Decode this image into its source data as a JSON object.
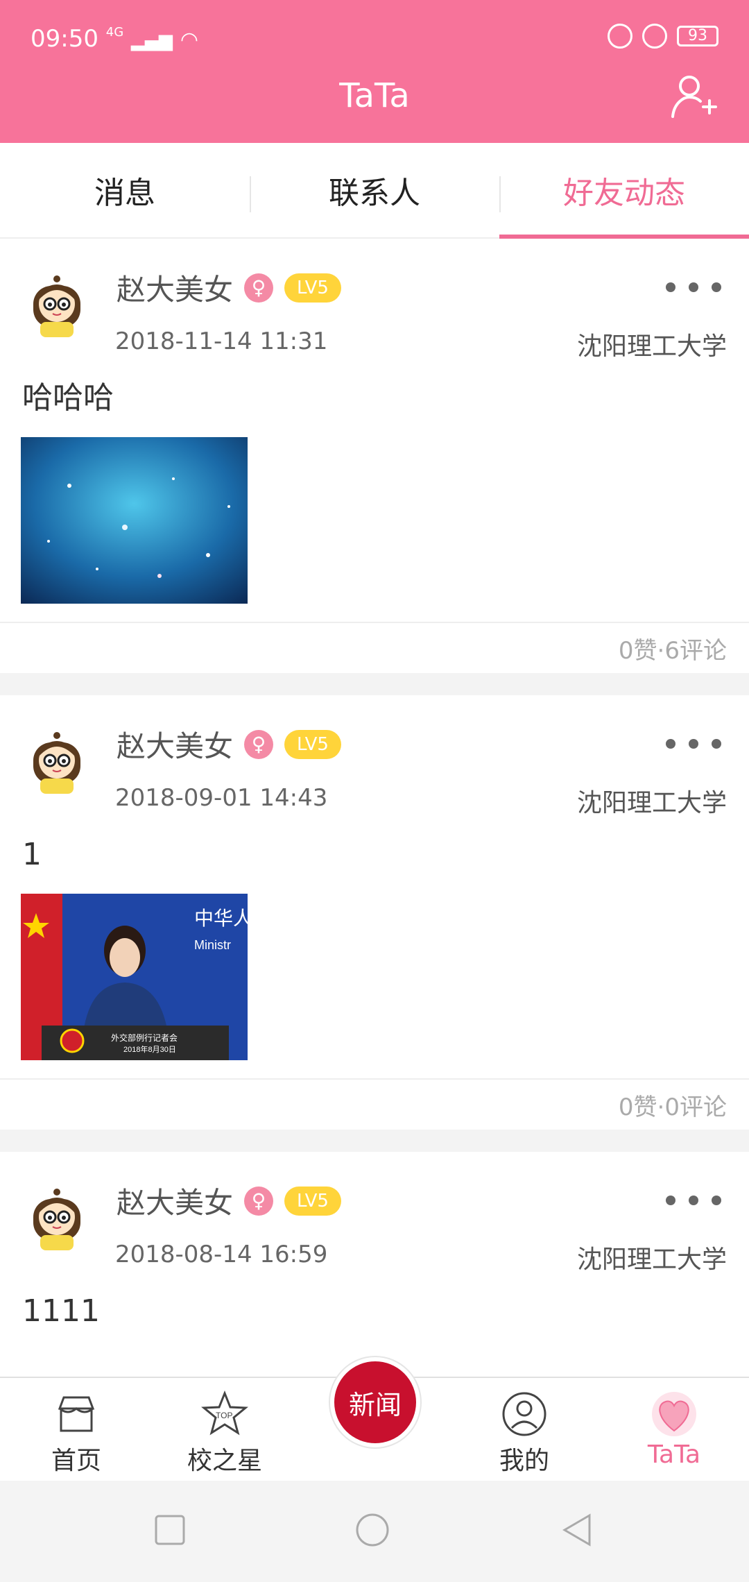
{
  "status_bar": {
    "time": "09:50",
    "network": "4G",
    "battery": "93"
  },
  "header": {
    "title": "TaTa",
    "add_icon": "add-friend-icon"
  },
  "tabs": [
    {
      "label": "消息",
      "active": false
    },
    {
      "label": "联系人",
      "active": false
    },
    {
      "label": "好友动态",
      "active": true
    }
  ],
  "posts": [
    {
      "name": "赵大美女",
      "gender": "♀",
      "level": "LV5",
      "time": "2018-11-14 11:31",
      "school": "沈阳理工大学",
      "text": "哈哈哈",
      "stats": "0赞·6评论",
      "photo": "galaxy"
    },
    {
      "name": "赵大美女",
      "gender": "♀",
      "level": "LV5",
      "time": "2018-09-01 14:43",
      "school": "沈阳理工大学",
      "text": "1",
      "stats": "0赞·0评论",
      "photo": "press"
    },
    {
      "name": "赵大美女",
      "gender": "♀",
      "level": "LV5",
      "time": "2018-08-14 16:59",
      "school": "沈阳理工大学",
      "text": "1111"
    }
  ],
  "photo_captions": {
    "press_line1": "外交部例行记者会",
    "press_line2": "2018年8月30日",
    "press_sign1": "中华人",
    "press_sign2": "Ministr"
  },
  "bottom_nav": {
    "home": "首页",
    "star": "校之星",
    "star_badge": "TOP",
    "news": "新闻",
    "mine": "我的",
    "tata": "TaTa"
  },
  "colors": {
    "accent": "#f7739a",
    "tab_active": "#f06b94",
    "level_badge": "#ffd43a",
    "news": "#c8102e"
  }
}
